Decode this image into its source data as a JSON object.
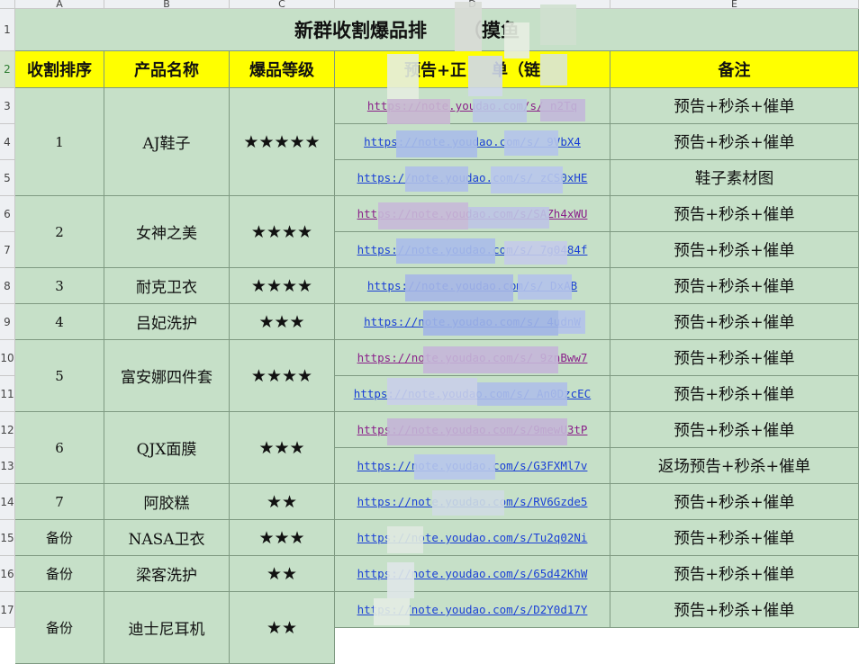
{
  "columns": [
    "A",
    "B",
    "C",
    "D",
    "E"
  ],
  "row_numbers": [
    "1",
    "2",
    "3",
    "4",
    "5",
    "6",
    "7",
    "8",
    "9",
    "10",
    "11",
    "12",
    "13",
    "14",
    "15",
    "16",
    "17"
  ],
  "title": "新群收割爆品排",
  "title_tail": "（摸鱼",
  "headers": {
    "rank": "收割排序",
    "product": "产品名称",
    "level": "爆品等级",
    "links": "预告+正",
    "links_mid": "单（链",
    "note": "备注"
  },
  "groups": [
    {
      "rank": "1",
      "product": "AJ鞋子",
      "stars": "★★★★★"
    },
    {
      "rank": "2",
      "product": "女神之美",
      "stars": "★★★★"
    },
    {
      "rank": "3",
      "product": "耐克卫衣",
      "stars": "★★★★"
    },
    {
      "rank": "4",
      "product": "吕妃洗护",
      "stars": "★★★"
    },
    {
      "rank": "5",
      "product": "富安娜四件套",
      "stars": "★★★★"
    },
    {
      "rank": "6",
      "product": "QJX面膜",
      "stars": "★★★"
    },
    {
      "rank": "7",
      "product": "阿胶糕",
      "stars": "★★"
    },
    {
      "rank": "备份",
      "product": "NASA卫衣",
      "stars": "★★★"
    },
    {
      "rank": "备份",
      "product": "梁客洗护",
      "stars": "★★"
    },
    {
      "rank": "备份",
      "product": "迪士尼耳机",
      "stars": "★★"
    }
  ],
  "rows": [
    {
      "link": "https://note.youdao.com/s/    n2Tq",
      "visited": true,
      "note": "预告+秒杀+催单"
    },
    {
      "link": "https://note.youdao.com/s/ 9VbX4",
      "visited": false,
      "note": "预告+秒杀+催单"
    },
    {
      "link": "https://note.youdao.com/s/ zCS0xHE",
      "visited": false,
      "note": "鞋子素材图"
    },
    {
      "link": "https://note.youdao.com/s/SAZh4xWU",
      "visited": true,
      "note": "预告+秒杀+催单"
    },
    {
      "link": "https://note.youdao.com/s/ 7g0484f",
      "visited": false,
      "note": "预告+秒杀+催单"
    },
    {
      "link": "https://note.youdao.com/s/  DxAB",
      "visited": false,
      "note": "预告+秒杀+催单"
    },
    {
      "link": "https://note.youdao.com/s/ 4udnW",
      "visited": false,
      "note": "预告+秒杀+催单"
    },
    {
      "link": "https://note.youdao.com/s/ 9znBww7",
      "visited": true,
      "note": "预告+秒杀+催单"
    },
    {
      "link": "https://note.youdao.com/s/ An0DzcEC",
      "visited": false,
      "note": "预告+秒杀+催单"
    },
    {
      "link": "https://note.youdao.com/s/9mewU3tP",
      "visited": true,
      "note": "预告+秒杀+催单"
    },
    {
      "link": "https://note.youdao.com/s/G3FXMl7v",
      "visited": false,
      "note": "返场预告+秒杀+催单"
    },
    {
      "link": "https://note.youdao.com/s/RV6Gzde5",
      "visited": false,
      "note": "预告+秒杀+催单"
    },
    {
      "link": "https://note.youdao.com/s/Tu2q02Ni",
      "visited": false,
      "note": "预告+秒杀+催单"
    },
    {
      "link": "https://note.youdao.com/s/65d42KhW",
      "visited": false,
      "note": "预告+秒杀+催单"
    },
    {
      "link": "https://note.youdao.com/s/D2Y0d17Y",
      "visited": false,
      "note": "预告+秒杀+催单"
    }
  ],
  "colors": {
    "header_fill": "#ffff00",
    "cell_fill": "#c6e0c8",
    "link": "#1a3fd6",
    "visited_link": "#8a1f8a"
  }
}
